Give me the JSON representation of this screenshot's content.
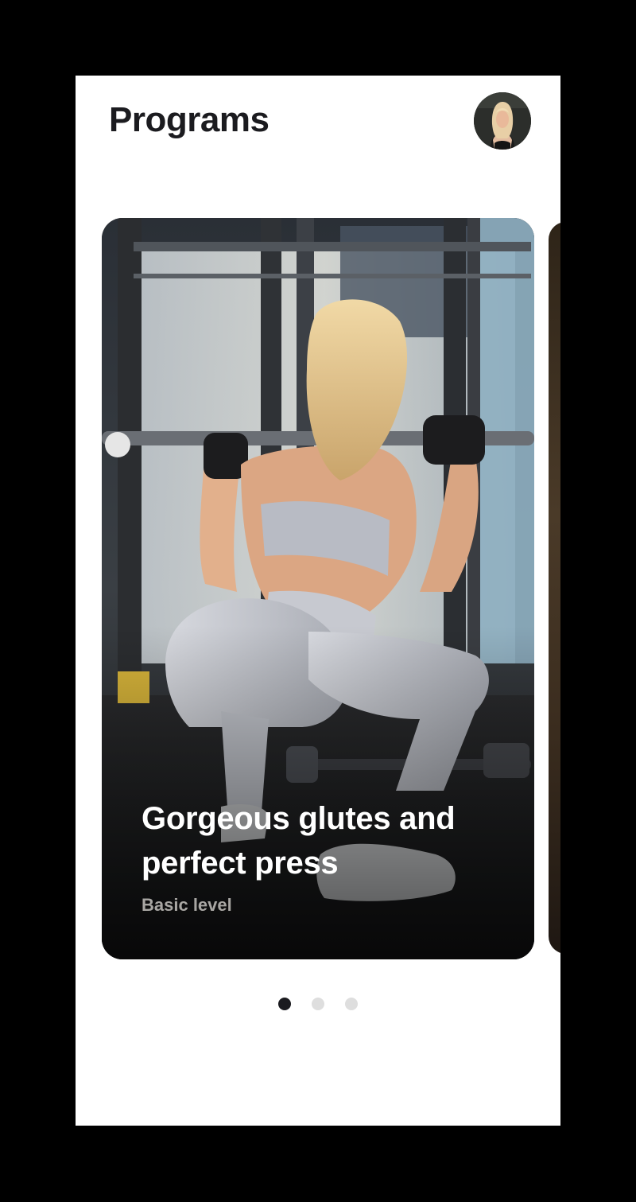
{
  "header": {
    "title": "Programs",
    "avatar_icon": "user-avatar"
  },
  "carousel": {
    "cards": [
      {
        "title": "Gorgeous glutes and perfect press",
        "level": "Basic level",
        "image_icon": "gym-squat-photo"
      },
      {
        "image_icon": "next-program-photo"
      }
    ],
    "pager": {
      "count": 3,
      "active_index": 0
    }
  },
  "colors": {
    "title": "#1b1b1f",
    "background": "#ffffff",
    "frame": "#000000",
    "dot_active": "#1b1b1f",
    "dot_inactive": "#dedede",
    "card_subtitle": "#a8a6a3"
  }
}
